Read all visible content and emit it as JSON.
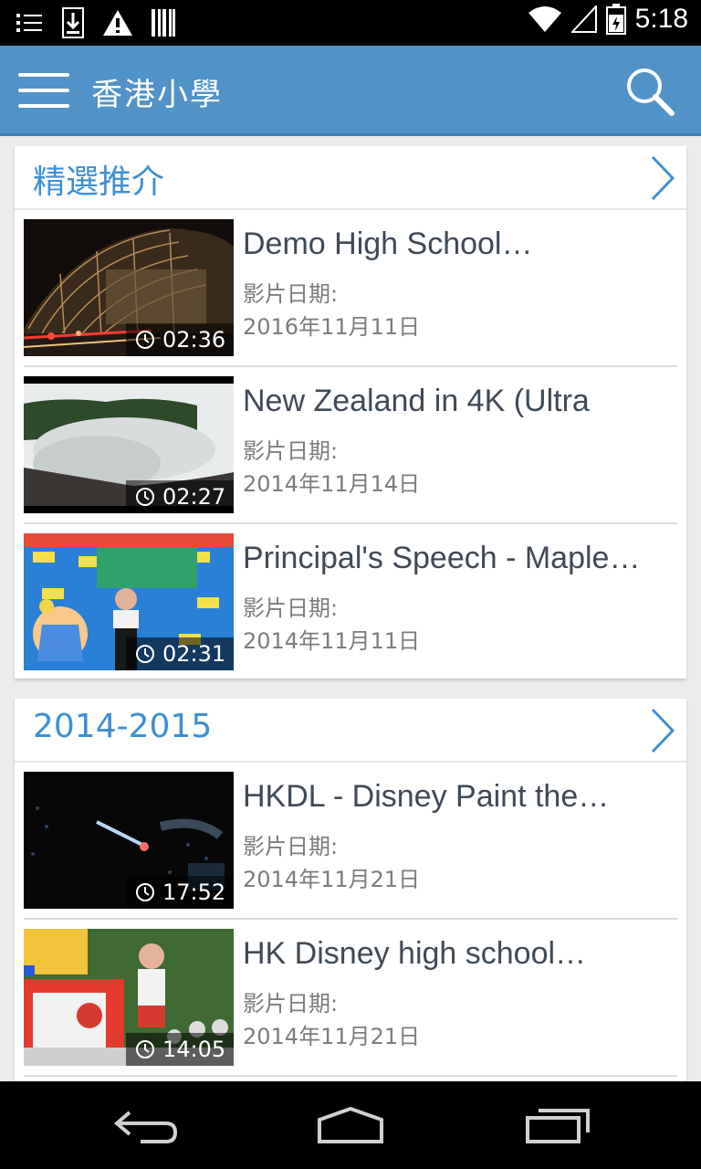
{
  "status_bar": {
    "time": "5:18"
  },
  "app_bar": {
    "title": "香港小學"
  },
  "sections": [
    {
      "title": "精選推介",
      "videos": [
        {
          "title": "Demo High School…",
          "date_label": "影片日期:",
          "date": "2016年11月11日",
          "duration": "02:36"
        },
        {
          "title": "New Zealand in 4K (Ultra",
          "date_label": "影片日期:",
          "date": "2014年11月14日",
          "duration": "02:27"
        },
        {
          "title": "Principal's Speech - Maple…",
          "date_label": "影片日期:",
          "date": "2014年11月11日",
          "duration": "02:31"
        }
      ]
    },
    {
      "title": "2014-2015",
      "videos": [
        {
          "title": "HKDL - Disney Paint the…",
          "date_label": "影片日期:",
          "date": "2014年11月21日",
          "duration": "17:52"
        },
        {
          "title": "HK Disney high school…",
          "date_label": "影片日期:",
          "date": "2014年11月21日",
          "duration": "14:05"
        }
      ]
    }
  ],
  "icons": {
    "menu": "menu-icon",
    "search": "search-icon",
    "section_more": "chevron-right-icon",
    "duration": "clock-icon",
    "back": "back-icon",
    "home": "home-icon",
    "recents": "recents-icon"
  },
  "colors": {
    "app_bar": "#5192c8",
    "section_title": "#3d8fd6",
    "video_title": "#3f4a57",
    "meta": "#7c7c7c"
  }
}
